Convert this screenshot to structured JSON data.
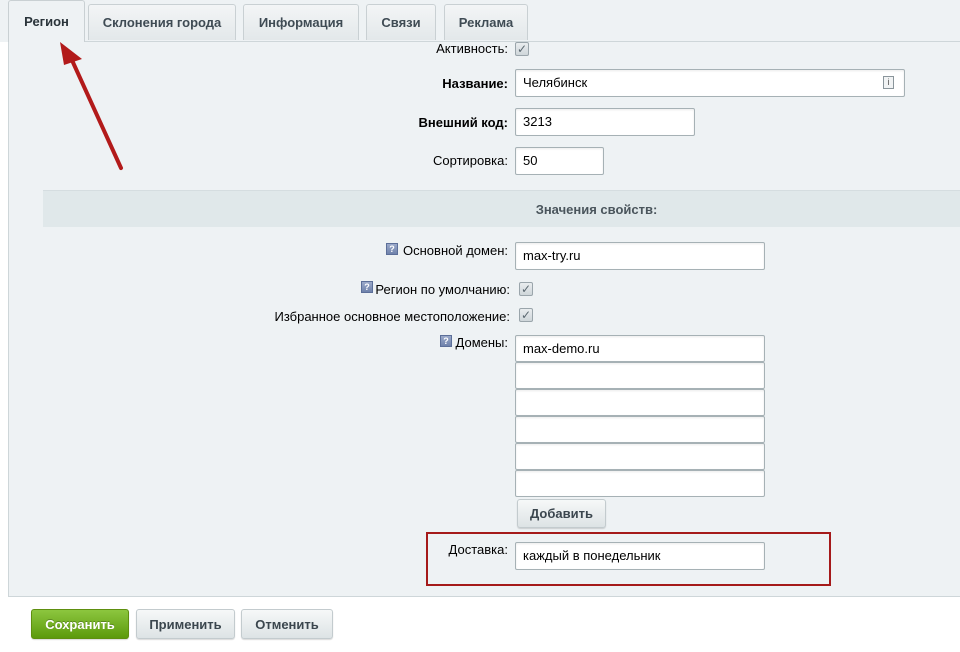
{
  "tabs": [
    {
      "label": "Регион",
      "active": true
    },
    {
      "label": "Склонения города"
    },
    {
      "label": "Информация"
    },
    {
      "label": "Связи"
    },
    {
      "label": "Реклама"
    }
  ],
  "fields": {
    "active_label": "Активность:",
    "name_label": "Название:",
    "name_value": "Челябинск",
    "ext_code_label": "Внешний код:",
    "ext_code_value": "3213",
    "sort_label": "Сортировка:",
    "sort_value": "50"
  },
  "props": {
    "section_title": "Значения свойств:",
    "main_domain_label": "Основной домен:",
    "main_domain_value": "max-try.ru",
    "default_region_label": "Регион по умолчанию:",
    "favorite_location_label": "Избранное основное местоположение:",
    "domains_label": "Домены:",
    "domains_values": [
      "max-demo.ru",
      "",
      "",
      "",
      "",
      ""
    ],
    "add_button": "Добавить",
    "delivery_label": "Доставка:",
    "delivery_value": "каждый в понедельник"
  },
  "footer": {
    "save": "Сохранить",
    "apply": "Применить",
    "cancel": "Отменить"
  },
  "colors": {
    "accent_green": "#6aa819",
    "annotation_red": "#a51a1a"
  }
}
